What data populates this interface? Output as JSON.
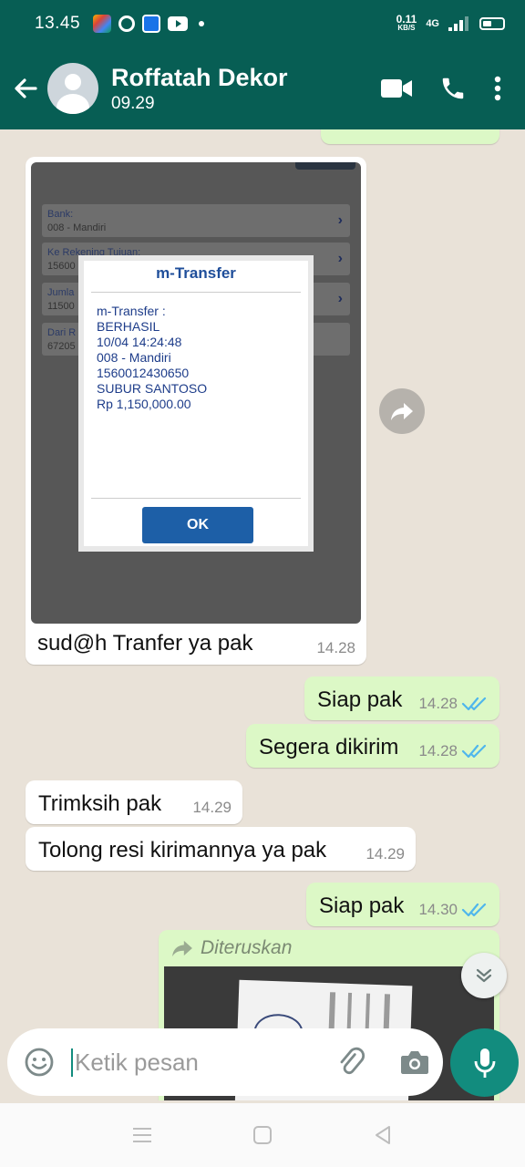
{
  "status_bar": {
    "time": "13.45",
    "speed_value": "0.11",
    "speed_unit": "KB/S",
    "network": "4G"
  },
  "header": {
    "contact_name": "Roffatah Dekor",
    "subtitle": "09.29"
  },
  "colors": {
    "header_bg": "#075e54",
    "outgoing_bubble": "#dcf8c6",
    "incoming_bubble": "#ffffff",
    "accent": "#128c7e",
    "read_tick": "#4fb6ec",
    "chat_bg": "#e9e2d8"
  },
  "screenshot_image": {
    "rows": [
      {
        "label": "Bank:",
        "value": "008 - Mandiri"
      },
      {
        "label": "Ke Rekening Tujuan:",
        "value": "15600"
      },
      {
        "label": "Jumla",
        "value": "11500"
      },
      {
        "label": "Dari R",
        "value": "67205"
      }
    ],
    "dialog": {
      "title": "m-Transfer",
      "lines": [
        "m-Transfer :",
        "BERHASIL",
        "10/04 14:24:48",
        "008 - Mandiri",
        "1560012430650",
        "SUBUR SANTOSO",
        "Rp 1,150,000.00"
      ],
      "ok_label": "OK"
    }
  },
  "messages": [
    {
      "direction": "incoming",
      "type": "image",
      "caption": "sud@h  Tranfer ya pak",
      "time": "14.28"
    },
    {
      "direction": "outgoing",
      "text": "Siap pak",
      "time": "14.28",
      "status": "read"
    },
    {
      "direction": "outgoing",
      "text": "Segera dikirim",
      "time": "14.28",
      "status": "read"
    },
    {
      "direction": "incoming",
      "text": "Trimksih pak",
      "time": "14.29"
    },
    {
      "direction": "incoming",
      "text": "Tolong resi kirimannya ya pak",
      "time": "14.29"
    },
    {
      "direction": "outgoing",
      "text": "Siap pak",
      "time": "14.30",
      "status": "read"
    },
    {
      "direction": "outgoing",
      "type": "forwarded-image",
      "label": "Diteruskan"
    }
  ],
  "composer": {
    "placeholder": "Ketik pesan"
  },
  "icons": [
    "back-arrow-icon",
    "avatar",
    "video-call-icon",
    "phone-icon",
    "more-vert-icon",
    "forward-icon",
    "scroll-down-icon",
    "emoji-icon",
    "attach-icon",
    "camera-icon",
    "mic-icon",
    "nav-menu-icon",
    "nav-home-icon",
    "nav-back-icon"
  ]
}
